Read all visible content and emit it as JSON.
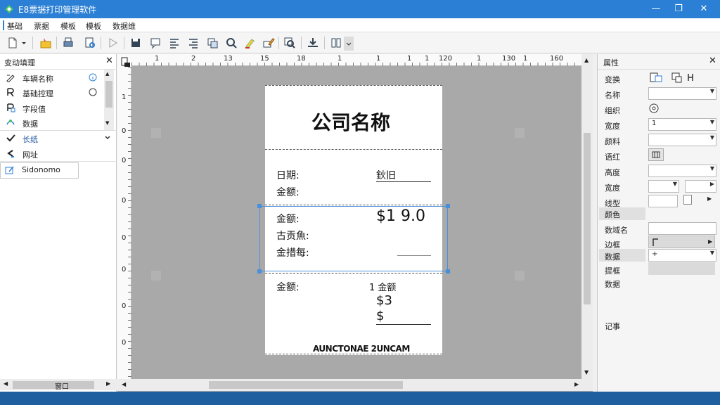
{
  "window": {
    "title": "E8票据打印管理软件"
  },
  "menu": [
    "基础",
    "票据",
    "模板",
    "模板",
    "数据维"
  ],
  "left_panel": {
    "title": "变动填理",
    "items": [
      {
        "label": "车辆名称",
        "icon": "edit-field-icon",
        "trailing": "info"
      },
      {
        "label": "基础控理",
        "icon": "text-field-icon",
        "trailing": "radio"
      },
      {
        "label": "字段值",
        "icon": "form-field-icon"
      },
      {
        "label": "数据",
        "icon": "data-field-icon"
      },
      {
        "label": "长纸",
        "icon": "check-icon"
      },
      {
        "label": "网址",
        "icon": "link-icon"
      },
      {
        "label": "Sidonomo",
        "icon": "edit-box-icon"
      }
    ],
    "bottom_label": "窗口"
  },
  "ruler": [
    "1",
    "2",
    "13",
    "15",
    "18",
    "1",
    "1",
    "1",
    "1",
    "120",
    "1",
    "130",
    "1",
    "160"
  ],
  "vruler": [
    "1",
    "0",
    "0",
    "0",
    "0",
    "0",
    "0",
    "0"
  ],
  "receipt": {
    "company": "公司名称",
    "date_label": "日期:",
    "date_value": "鈥旧",
    "amount_label1": "金额:",
    "amount_label2": "金额:",
    "amount_value": "$1  9.0",
    "line3": "古贡魚:",
    "line4": "金措每:",
    "amount_label3": "金额:",
    "amount_value3": "1 金额",
    "value_s2": "$3",
    "value_s": "$",
    "footer": "AUNCTONAE 2UNCAM"
  },
  "right_panel": {
    "title": "属性",
    "rows": [
      {
        "label": "变换"
      },
      {
        "label": "名称"
      },
      {
        "label": "组织"
      },
      {
        "label": "宽度",
        "value": "1"
      },
      {
        "label": "颜料"
      },
      {
        "label": "语红"
      },
      {
        "label": "高度"
      },
      {
        "label": "宽度"
      },
      {
        "label": "线型"
      },
      {
        "label": "颜色"
      },
      {
        "label": "数域名"
      },
      {
        "label": "边框"
      },
      {
        "label": "数据",
        "value": "+"
      },
      {
        "label": "提框"
      },
      {
        "label": "数据"
      }
    ],
    "note_label": "记事"
  },
  "colors": {
    "titlebar": "#2b7fd4",
    "statusbar": "#1e5f9f",
    "selection": "#4a90d9"
  }
}
